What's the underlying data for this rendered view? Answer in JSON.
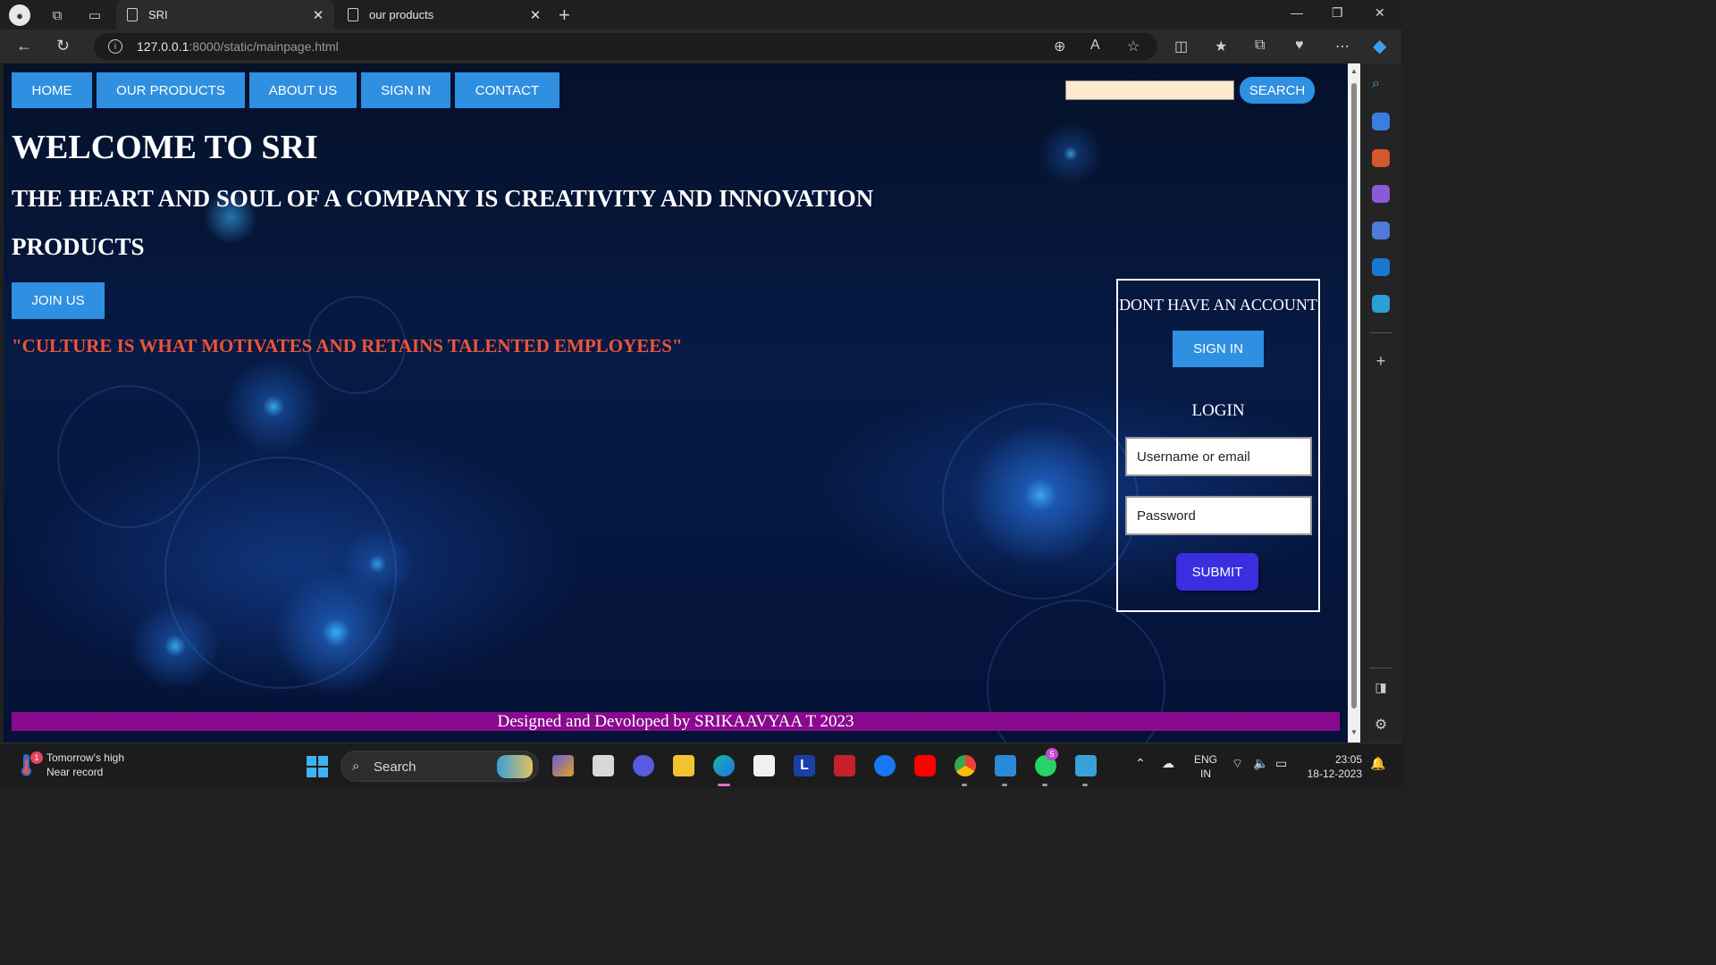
{
  "browser": {
    "tabs": [
      {
        "label": "SRI",
        "active": true
      },
      {
        "label": "our products",
        "active": false
      }
    ],
    "url_host": "127.0.0.1",
    "url_rest": ":8000/static/mainpage.html"
  },
  "page": {
    "nav": [
      "HOME",
      "OUR PRODUCTS",
      "ABOUT US",
      "SIGN IN",
      "CONTACT"
    ],
    "search_button": "SEARCH",
    "search_value": "",
    "heading": "WELCOME TO SRI",
    "tagline": "THE HEART AND SOUL OF A COMPANY IS CREATIVITY AND INNOVATION",
    "products_heading": "PRODUCTS",
    "join_button": "JOIN US",
    "quote": "\"CULTURE IS WHAT MOTIVATES AND RETAINS TALENTED EMPLOYEES\"",
    "login_box": {
      "title": "DONT HAVE AN ACCOUNT",
      "signin_button": "SIGN IN",
      "login_label": "LOGIN",
      "username_placeholder": "Username or email",
      "password_placeholder": "Password",
      "submit_button": "SUBMIT"
    },
    "footer": "Designed and Devoloped by SRIKAAVYAA T 2023"
  },
  "taskbar": {
    "weather_line1": "Tomorrow's high",
    "weather_line2": "Near record",
    "weather_badge": "1",
    "search_label": "Search",
    "whatsapp_badge": "5",
    "lang_line1": "ENG",
    "lang_line2": "IN",
    "time": "23:05",
    "date": "18-12-2023"
  },
  "colors": {
    "nav_blue": "#2f8fe0",
    "quote_red": "#f0533a",
    "footer_purple": "#8a0a8f",
    "submit_indigo": "#3a2ee0",
    "search_input_bg": "#fde9cf"
  }
}
